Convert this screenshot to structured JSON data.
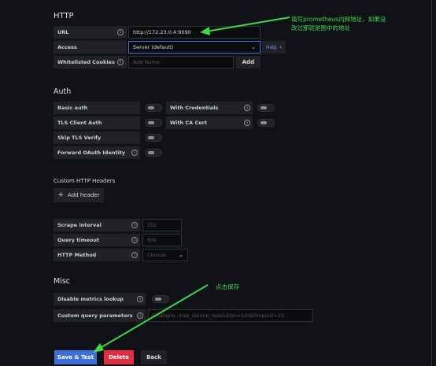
{
  "http": {
    "title": "HTTP",
    "url_label": "URL",
    "url_value": "http://172.23.0.4:9090",
    "access_label": "Access",
    "access_value": "Server (default)",
    "help_label": "Help",
    "cookies_label": "Whitelisted Cookies",
    "cookies_placeholder": "Add Name",
    "add_label": "Add"
  },
  "auth": {
    "title": "Auth",
    "basic_auth": "Basic auth",
    "with_credentials": "With Credentials",
    "tls_client_auth": "TLS Client Auth",
    "with_ca_cert": "With CA Cert",
    "skip_tls_verify": "Skip TLS Verify",
    "forward_oauth": "Forward OAuth Identity"
  },
  "custom_headers": {
    "title": "Custom HTTP Headers",
    "add_header": "Add header"
  },
  "prometheus": {
    "scrape_label": "Scrape interval",
    "scrape_placeholder": "15s",
    "query_timeout_label": "Query timeout",
    "query_timeout_placeholder": "60s",
    "http_method_label": "HTTP Method",
    "http_method_value": "Choose"
  },
  "misc": {
    "title": "Misc",
    "disable_metrics": "Disable metrics lookup",
    "custom_query_label": "Custom query parameters",
    "custom_query_placeholder": "Example: max_source_resolution=5m&timeout=10"
  },
  "actions": {
    "save_test": "Save & Test",
    "delete": "Delete",
    "back": "Back"
  },
  "annotations": {
    "url_note_line1": "填写prometheus内网地址，如果没",
    "url_note_line2": "改过那就是图中的地址",
    "save_note": "点击保存"
  },
  "colors": {
    "primary": "#3d71d9",
    "danger": "#e02f44",
    "annotation": "#3dd94d"
  }
}
